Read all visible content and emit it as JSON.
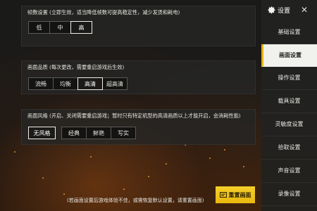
{
  "sections": {
    "frame_rate": {
      "title": "帧数设置 (立即生效，适当降低帧数可提高稳定性，减少发烫和耗电)",
      "options": [
        "低",
        "中",
        "高"
      ],
      "selected": "高"
    },
    "quality": {
      "title": "画面品质 (每次更改，需要重启游戏后生效)",
      "options": [
        "流畅",
        "均衡",
        "高清",
        "超高清"
      ],
      "selected": "高清"
    },
    "style": {
      "title": "画面风格 (开启、关闭需要重启游戏；暂时只有特定机型的高清画质以上才能开启，会消耗性能)",
      "options": [
        "无风格",
        "经典",
        "鲜艳",
        "写实"
      ],
      "selected": "无风格"
    }
  },
  "sidebar": {
    "title": "设置",
    "close_icon": "close-icon",
    "items": [
      {
        "label": "基础设置"
      },
      {
        "label": "画面设置",
        "active": true
      },
      {
        "label": "操作设置"
      },
      {
        "label": "载具设置"
      },
      {
        "label": "灵敏度设置"
      },
      {
        "label": "拾取设置"
      },
      {
        "label": "声音设置"
      },
      {
        "label": "录像设置"
      }
    ]
  },
  "footer": {
    "note": "(若画面设置后游戏体验不佳，或需恢复默认设置，请重置画面)",
    "reset_label": "重置画面"
  },
  "colors": {
    "accent": "#f1c40f",
    "active_border": "#f1efe6"
  }
}
